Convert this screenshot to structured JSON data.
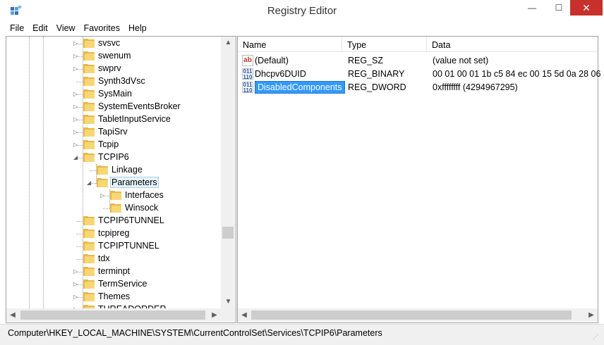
{
  "window": {
    "title": "Registry Editor",
    "min": "—",
    "max": "☐",
    "close": "✕"
  },
  "menu": [
    "File",
    "Edit",
    "View",
    "Favorites",
    "Help"
  ],
  "tree": [
    {
      "label": "svsvc",
      "level": 0,
      "expander": "collapsed"
    },
    {
      "label": "swenum",
      "level": 0,
      "expander": "collapsed"
    },
    {
      "label": "swprv",
      "level": 0,
      "expander": "collapsed"
    },
    {
      "label": "Synth3dVsc",
      "level": 0,
      "expander": "none"
    },
    {
      "label": "SysMain",
      "level": 0,
      "expander": "collapsed"
    },
    {
      "label": "SystemEventsBroker",
      "level": 0,
      "expander": "collapsed"
    },
    {
      "label": "TabletInputService",
      "level": 0,
      "expander": "collapsed"
    },
    {
      "label": "TapiSrv",
      "level": 0,
      "expander": "collapsed"
    },
    {
      "label": "Tcpip",
      "level": 0,
      "expander": "collapsed"
    },
    {
      "label": "TCPIP6",
      "level": 0,
      "expander": "expanded"
    },
    {
      "label": "Linkage",
      "level": 1,
      "expander": "none"
    },
    {
      "label": "Parameters",
      "level": 1,
      "expander": "expanded",
      "selected": true
    },
    {
      "label": "Interfaces",
      "level": 2,
      "expander": "collapsed"
    },
    {
      "label": "Winsock",
      "level": 2,
      "expander": "none"
    },
    {
      "label": "TCPIP6TUNNEL",
      "level": 0,
      "expander": "none"
    },
    {
      "label": "tcpipreg",
      "level": 0,
      "expander": "none"
    },
    {
      "label": "TCPIPTUNNEL",
      "level": 0,
      "expander": "none"
    },
    {
      "label": "tdx",
      "level": 0,
      "expander": "none"
    },
    {
      "label": "terminpt",
      "level": 0,
      "expander": "collapsed"
    },
    {
      "label": "TermService",
      "level": 0,
      "expander": "collapsed"
    },
    {
      "label": "Themes",
      "level": 0,
      "expander": "collapsed"
    },
    {
      "label": "THREADORDER",
      "level": 0,
      "expander": "collapsed"
    }
  ],
  "list": {
    "columns": [
      "Name",
      "Type",
      "Data"
    ],
    "rows": [
      {
        "name": "(Default)",
        "type": "REG_SZ",
        "data": "(value not set)",
        "icon": "string-value-icon",
        "glyph": "ab"
      },
      {
        "name": "Dhcpv6DUID",
        "type": "REG_BINARY",
        "data": "00 01 00 01 1b c5 84 ec 00 15 5d 0a 28 06",
        "icon": "binary-value-icon",
        "glyph": "011\n110"
      },
      {
        "name": "DisabledComponents",
        "type": "REG_DWORD",
        "data": "0xffffffff (4294967295)",
        "icon": "binary-value-icon",
        "glyph": "011\n110",
        "selected": true
      }
    ]
  },
  "status": {
    "path": "Computer\\HKEY_LOCAL_MACHINE\\SYSTEM\\CurrentControlSet\\Services\\TCPIP6\\Parameters"
  },
  "colors": {
    "selection": "#3399ff",
    "close_button": "#c7302b",
    "folder": "#f7d774"
  }
}
